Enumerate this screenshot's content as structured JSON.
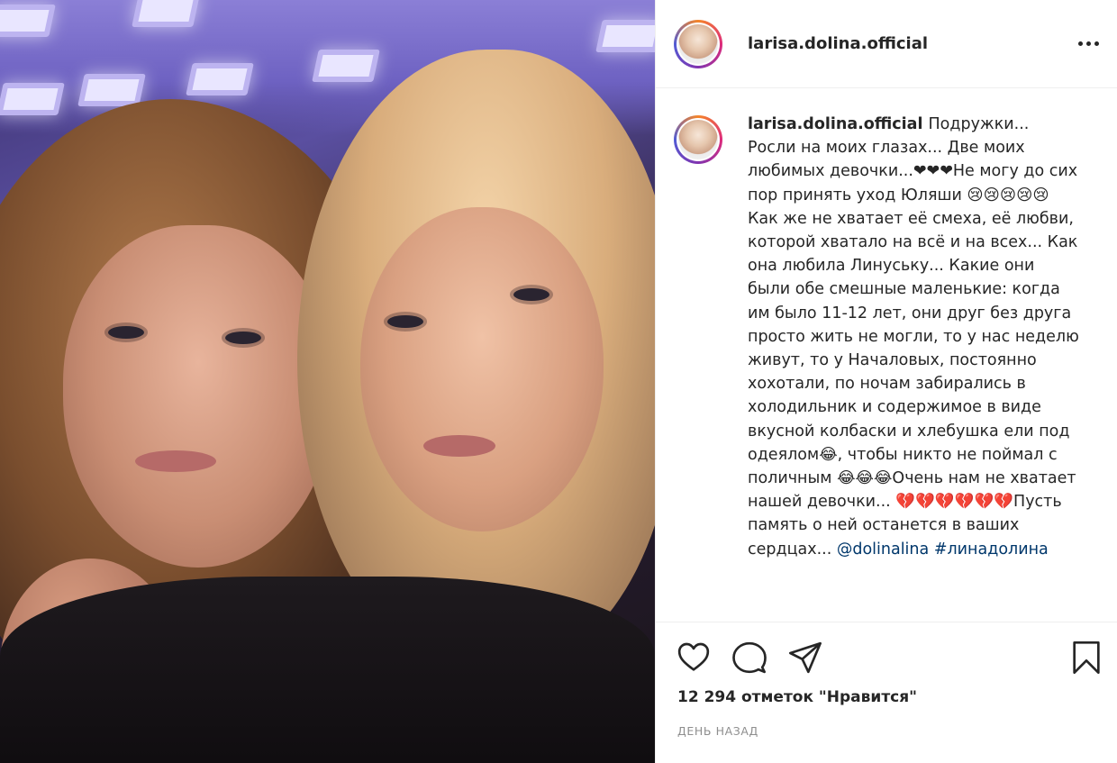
{
  "post": {
    "username": "larisa.dolina.official",
    "photo_alt": "selfie",
    "caption": {
      "username": "larisa.dolina.official",
      "text": "Подружки... Росли на моих глазах... Две моих любимых девочки...❤❤❤Не могу до сих пор принять уход Юляши 😢😢😢😢😢 Как же не хватает её смеха, её любви, которой хватало на всё и на всех... Как она любила Линуську... Какие они были обе смешные маленькие: когда им было 11-12 лет, они друг без друга просто жить не могли, то у нас неделю живут, то у Началовых, постоянно хохотали, по ночам забирались в холодильник и содержимое в виде вкусной колбаски и хлебушка ели под одеялом😂, чтобы никто не поймал с поличным 😂😂😂Очень нам не хватает нашей девочки... 💔💔💔💔💔💔Пусть память о ней останется в ваших сердцах... ",
      "mention": "@dolinalina",
      "hashtag": "#линадолина"
    },
    "likes_label": "12 294 отметок \"Нравится\"",
    "timestamp": "ДЕНЬ НАЗАД",
    "icons": {
      "like": "heart-icon",
      "comment": "comment-icon",
      "share": "share-icon",
      "save": "bookmark-icon",
      "more": "more-icon"
    }
  }
}
